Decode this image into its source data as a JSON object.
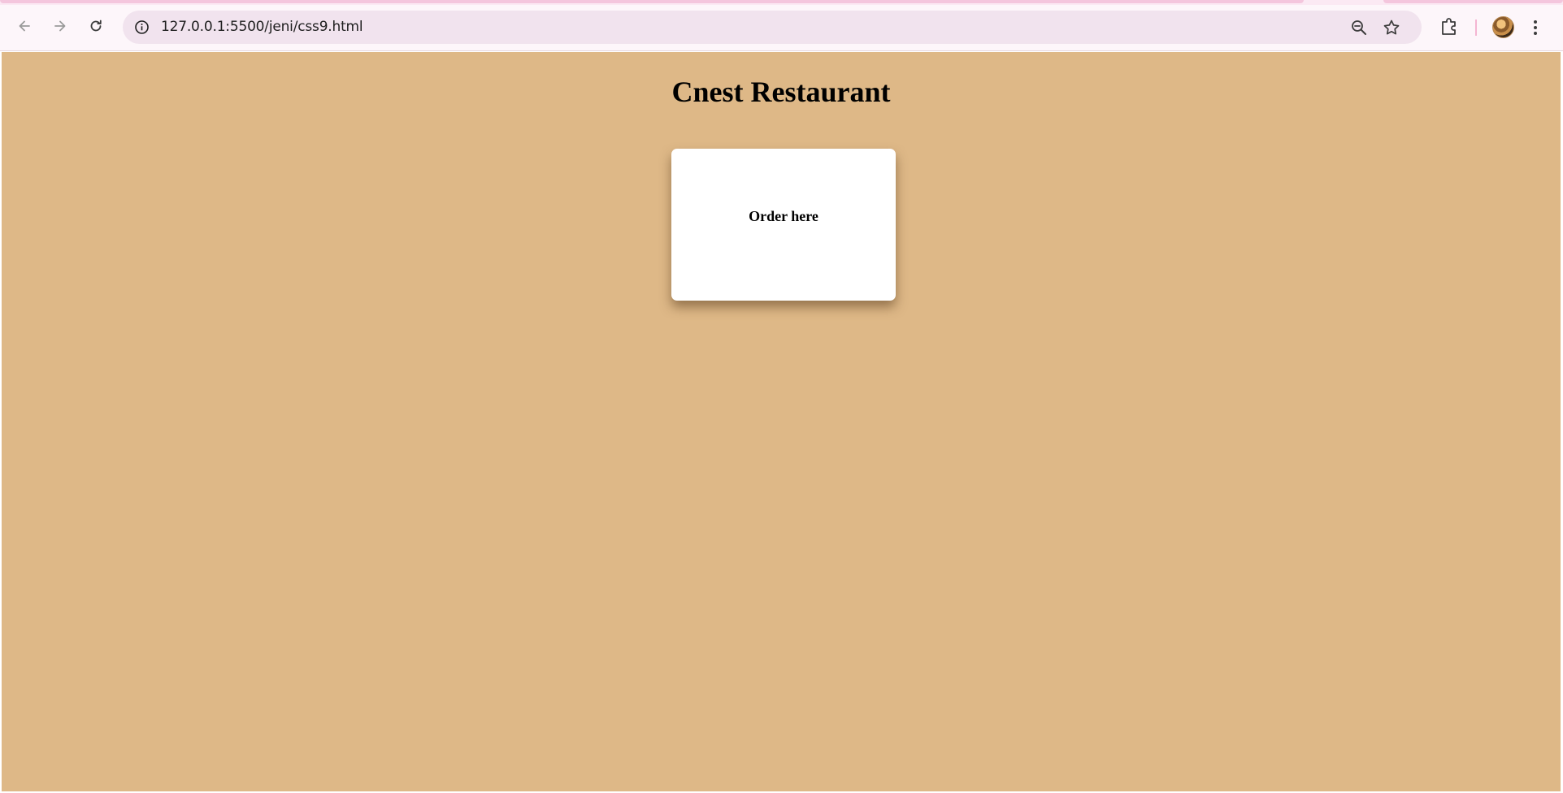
{
  "browser": {
    "url": "127.0.0.1:5500/jeni/css9.html",
    "icons": {
      "back": "arrow-left-icon",
      "forward": "arrow-right-icon",
      "reload": "reload-icon",
      "site_info": "info-icon",
      "zoom": "zoom-out-icon",
      "bookmark": "star-icon",
      "extensions": "puzzle-icon",
      "profile": "avatar",
      "menu": "kebab-menu-icon"
    },
    "colors": {
      "toolbar": "#fdf6fa",
      "omnibox": "#f1e3ee",
      "accent": "#f4b5d2"
    }
  },
  "page": {
    "title": "Cnest Restaurant",
    "card": {
      "label": "Order here"
    },
    "colors": {
      "background": "#deb887",
      "card": "#ffffff",
      "text": "#000000"
    }
  }
}
